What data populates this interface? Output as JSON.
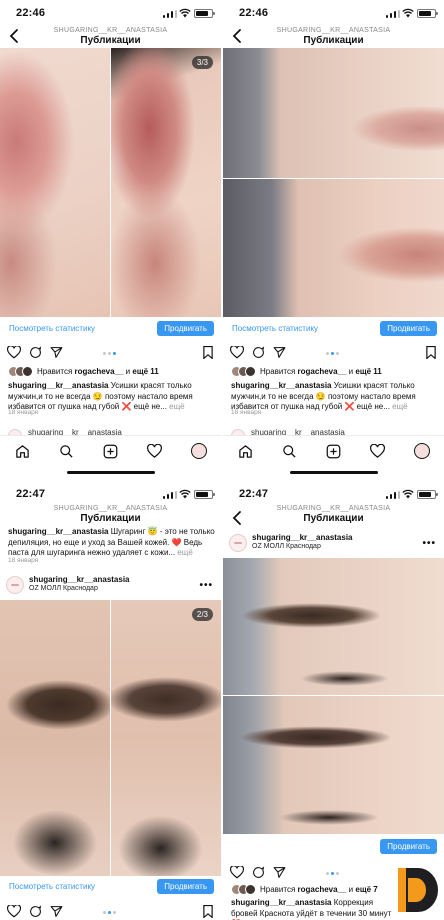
{
  "status_time": [
    "22:46",
    "22:46",
    "22:47",
    "22:47"
  ],
  "header": {
    "username": "SHUGARING__KR__ANASTASIA",
    "title": "Публикации"
  },
  "photo_counter": [
    "3/3",
    "2/3"
  ],
  "stats_link": "Посмотреть статистику",
  "promote_button": "Продвигать",
  "post1": {
    "likes_prefix": "Нравится ",
    "likes_user": "rogacheva__",
    "likes_mid": " и ",
    "likes_count": "ещё 11",
    "author": "shugaring__kr__anastasia",
    "text": " Усишки красят только мужчин,и то не всегда 😏 поэтому настало время избавится от пушка над губой ❌ ещё не...",
    "more": " ещё",
    "date": "18 января",
    "next_author": "shugaring__kr__anastasia"
  },
  "post2": {
    "caption_author": "shugaring__kr__anastasia",
    "caption_text": " Шугаринг 😇 - это не только депиляция, но еще и уход за Вашей кожей. ❤️ Ведь паста для шугаринга нежно удаляет с кожи...",
    "caption_more": " ещё",
    "date": "18 января",
    "author": "shugaring__kr__anastasia",
    "location": "OZ МОЛЛ Краснодар"
  },
  "post3": {
    "author": "shugaring__kr__anastasia",
    "location": "OZ МОЛЛ Краснодар",
    "likes_prefix": "Нравится ",
    "likes_user": "rogacheva__",
    "likes_mid": " и ",
    "likes_count": "ещё 7",
    "caption_author": "shugaring__kr__anastasia",
    "caption_text": " Коррекция бровей Краснота уйдёт в течении 30 минут ❤️"
  },
  "colors": {
    "accent": "#3897f0",
    "brand_orange": "#f39a1b",
    "brand_dark": "#1f1f22",
    "like_red": "#d2253d"
  },
  "icons": [
    "back-icon",
    "heart-icon",
    "comment-icon",
    "share-icon",
    "bookmark-icon",
    "home-icon",
    "search-icon",
    "add-icon",
    "profile-icon",
    "options-icon"
  ]
}
